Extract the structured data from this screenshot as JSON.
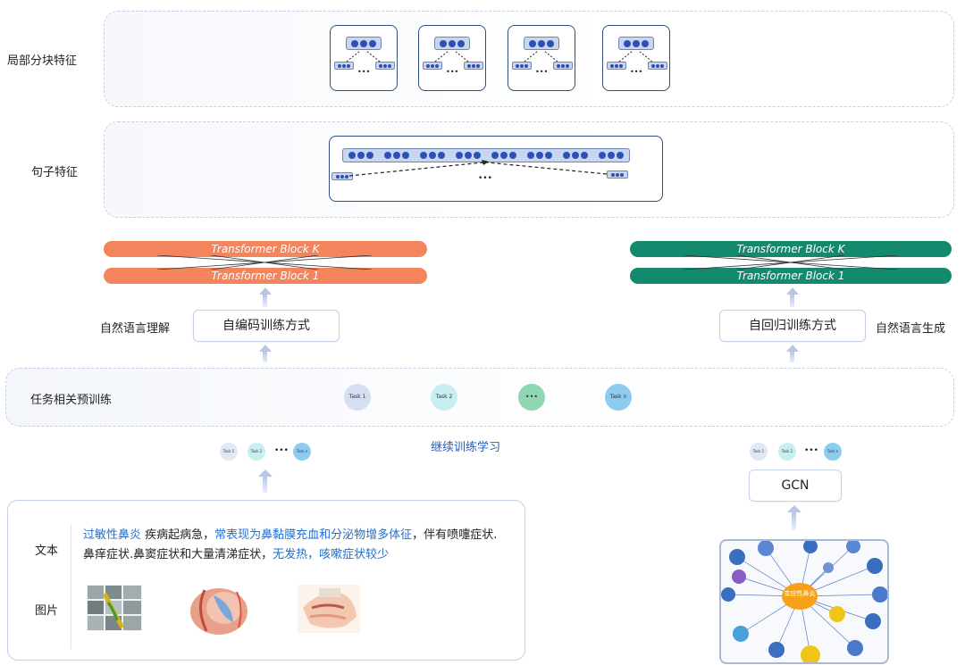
{
  "rows": {
    "local_label": "局部分块特征",
    "sentence_label": "句子特征",
    "task_label": "任务相关预训练"
  },
  "ellipsis": "•••",
  "left": {
    "block_top": "Transformer Block K",
    "block_bottom": "Transformer Block 1",
    "side_label": "自然语言理解",
    "method": "自编码训练方式"
  },
  "right": {
    "block_top": "Transformer Block K",
    "block_bottom": "Transformer Block 1",
    "side_label": "自然语言生成",
    "method": "自回归训练方式"
  },
  "tasks": {
    "task1": "Task 1",
    "task2": "Task 2",
    "dots": "•••",
    "taskn": "Task n"
  },
  "mini_tasks": {
    "t1": "Task 1",
    "t2": "Task 2",
    "tn": "Task n",
    "dots": "•••"
  },
  "continue_label": "继续训练学习",
  "gcn": "GCN",
  "info": {
    "text_label": "文本",
    "image_label": "图片",
    "seg1": "过敏性鼻炎",
    "seg2": " 疾病起病急，",
    "seg3": "常表现为鼻黏膜充血和分泌物增多体征",
    "seg4": "，伴有",
    "seg5": "喷嚏症状.鼻痒症状.鼻窦症状和大量清涕症状，",
    "seg6": "无发热，咳嗽症状较少"
  },
  "kg": {
    "center": "变应性鼻炎"
  },
  "colors": {
    "orange": "#f4845c",
    "teal": "#138a6e",
    "highlight": "#1f6fd1"
  }
}
